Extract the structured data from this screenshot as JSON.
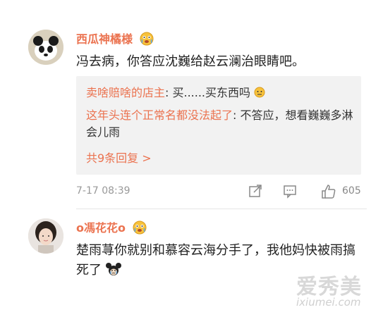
{
  "comment1": {
    "username": "西瓜神橘様",
    "badge_icon": "crying-face-emoji",
    "text": "冯去病，你答应沈巍给赵云澜治眼睛吧。",
    "replies": [
      {
        "name": "卖啥赔啥的店主",
        "text": ": 买......买东西吗",
        "emoji": "😶"
      },
      {
        "name": "这年头连个正常名都没法起了",
        "text": ": 不答应，想看巍巍多淋会儿雨"
      }
    ],
    "more_replies": "共9条回复 >",
    "timestamp": "7-17 08:39",
    "like_count": "605"
  },
  "comment2": {
    "username": "o馮花花o",
    "badge_icon": "crying-face-emoji",
    "text": "楚雨荨你就别和慕容云海分手了，我他妈快被雨搞死了",
    "text_emoji": "mickey-crying-emoji"
  },
  "watermark": {
    "cn": "爱秀美",
    "en": "ixiumei.com"
  },
  "colors": {
    "username": "#eb7350",
    "reply_bg": "#f2f2f2"
  }
}
